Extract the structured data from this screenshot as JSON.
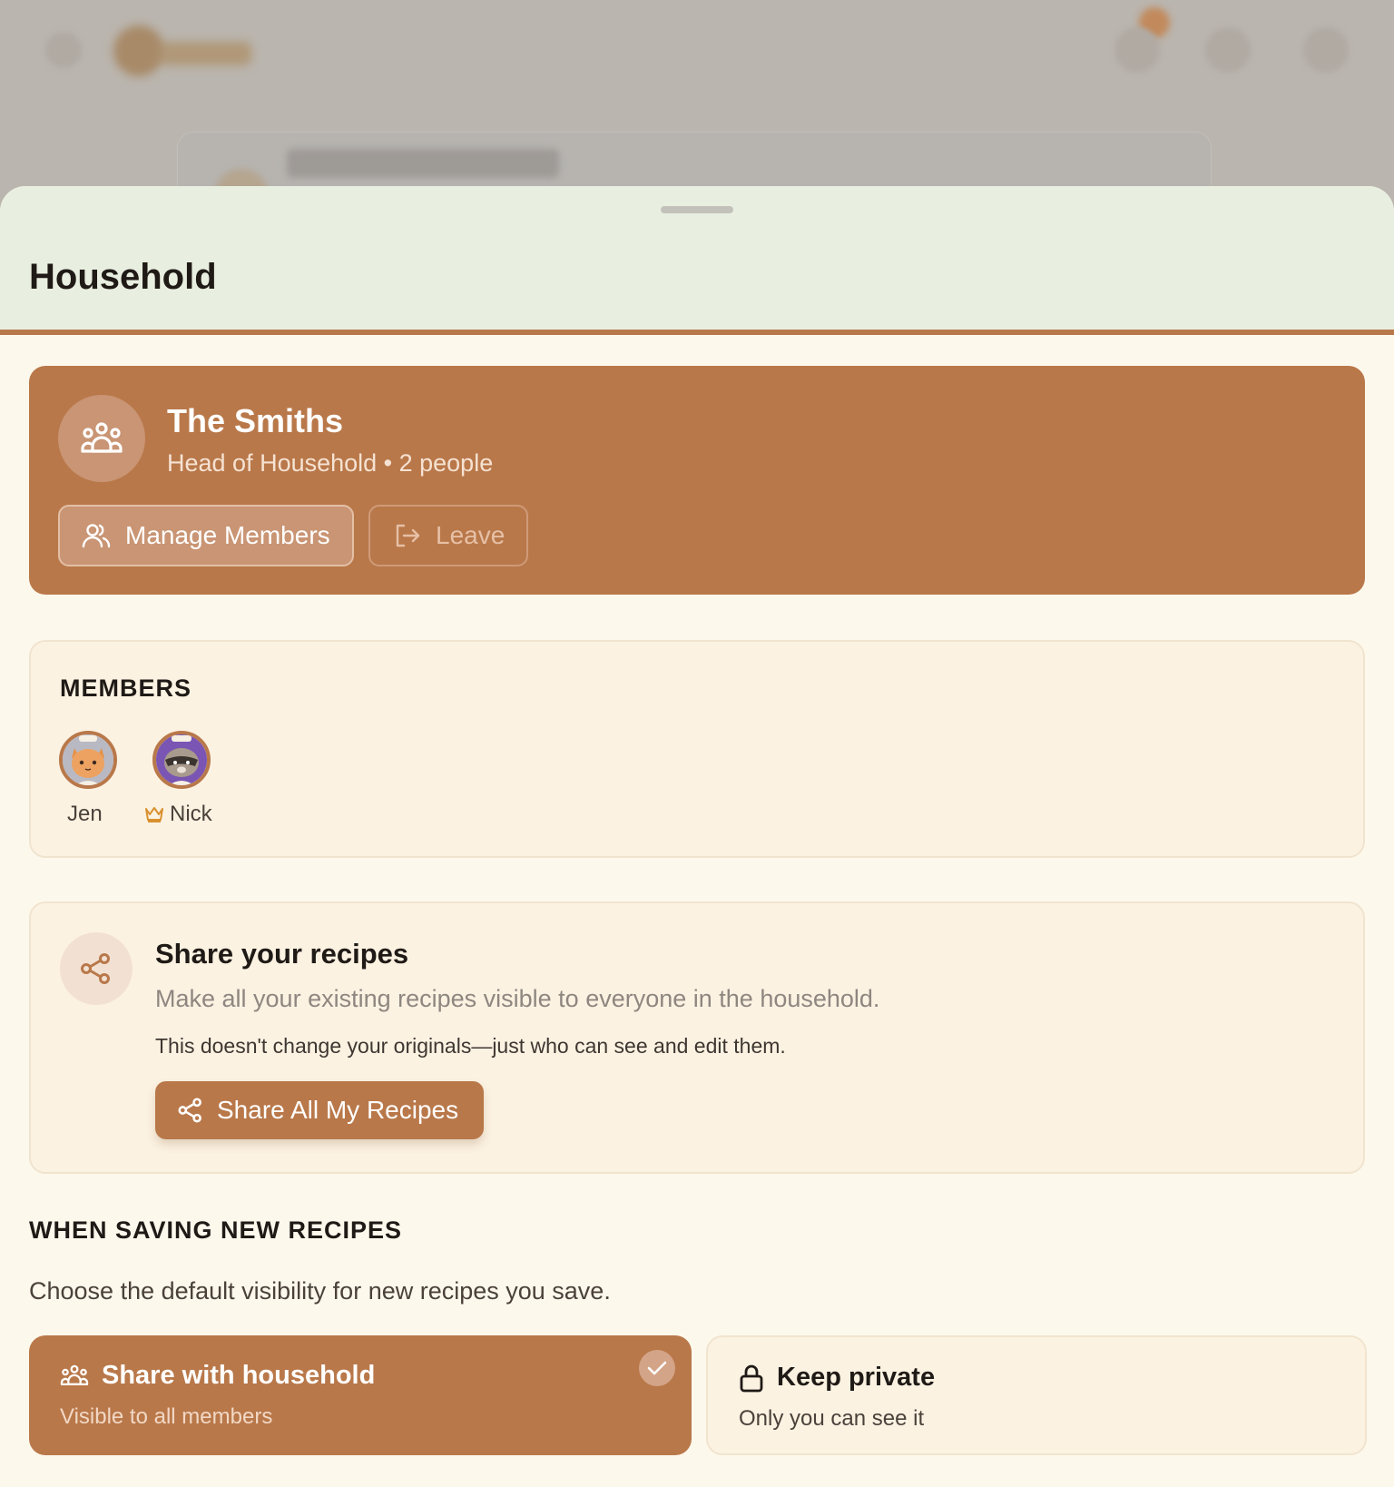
{
  "sheet": {
    "title": "Household"
  },
  "household": {
    "name": "The Smiths",
    "subtitle": "Head of Household • 2 people",
    "manage_label": "Manage Members",
    "leave_label": "Leave"
  },
  "members": {
    "label": "MEMBERS",
    "list": [
      {
        "name": "Jen",
        "avatar": "cat-chef-avatar",
        "is_head": false
      },
      {
        "name": "Nick",
        "avatar": "raccoon-chef-avatar",
        "is_head": true
      }
    ]
  },
  "share": {
    "title": "Share your recipes",
    "description": "Make all your existing recipes visible to everyone in the household.",
    "note": "This doesn't change your originals—just who can see and edit them.",
    "button_label": "Share All My Recipes"
  },
  "visibility": {
    "heading": "WHEN SAVING NEW RECIPES",
    "description": "Choose the default visibility for new recipes you save.",
    "options": [
      {
        "title": "Share with household",
        "subtitle": "Visible to all members",
        "selected": true,
        "icon": "users-icon"
      },
      {
        "title": "Keep private",
        "subtitle": "Only you can see it",
        "selected": false,
        "icon": "lock-icon"
      }
    ]
  },
  "colors": {
    "accent": "#b9784a",
    "sheet_background": "#fdf8ec",
    "header_background": "#e9efe0",
    "card_background": "#fcf2e2",
    "crown": "#d9912e"
  }
}
